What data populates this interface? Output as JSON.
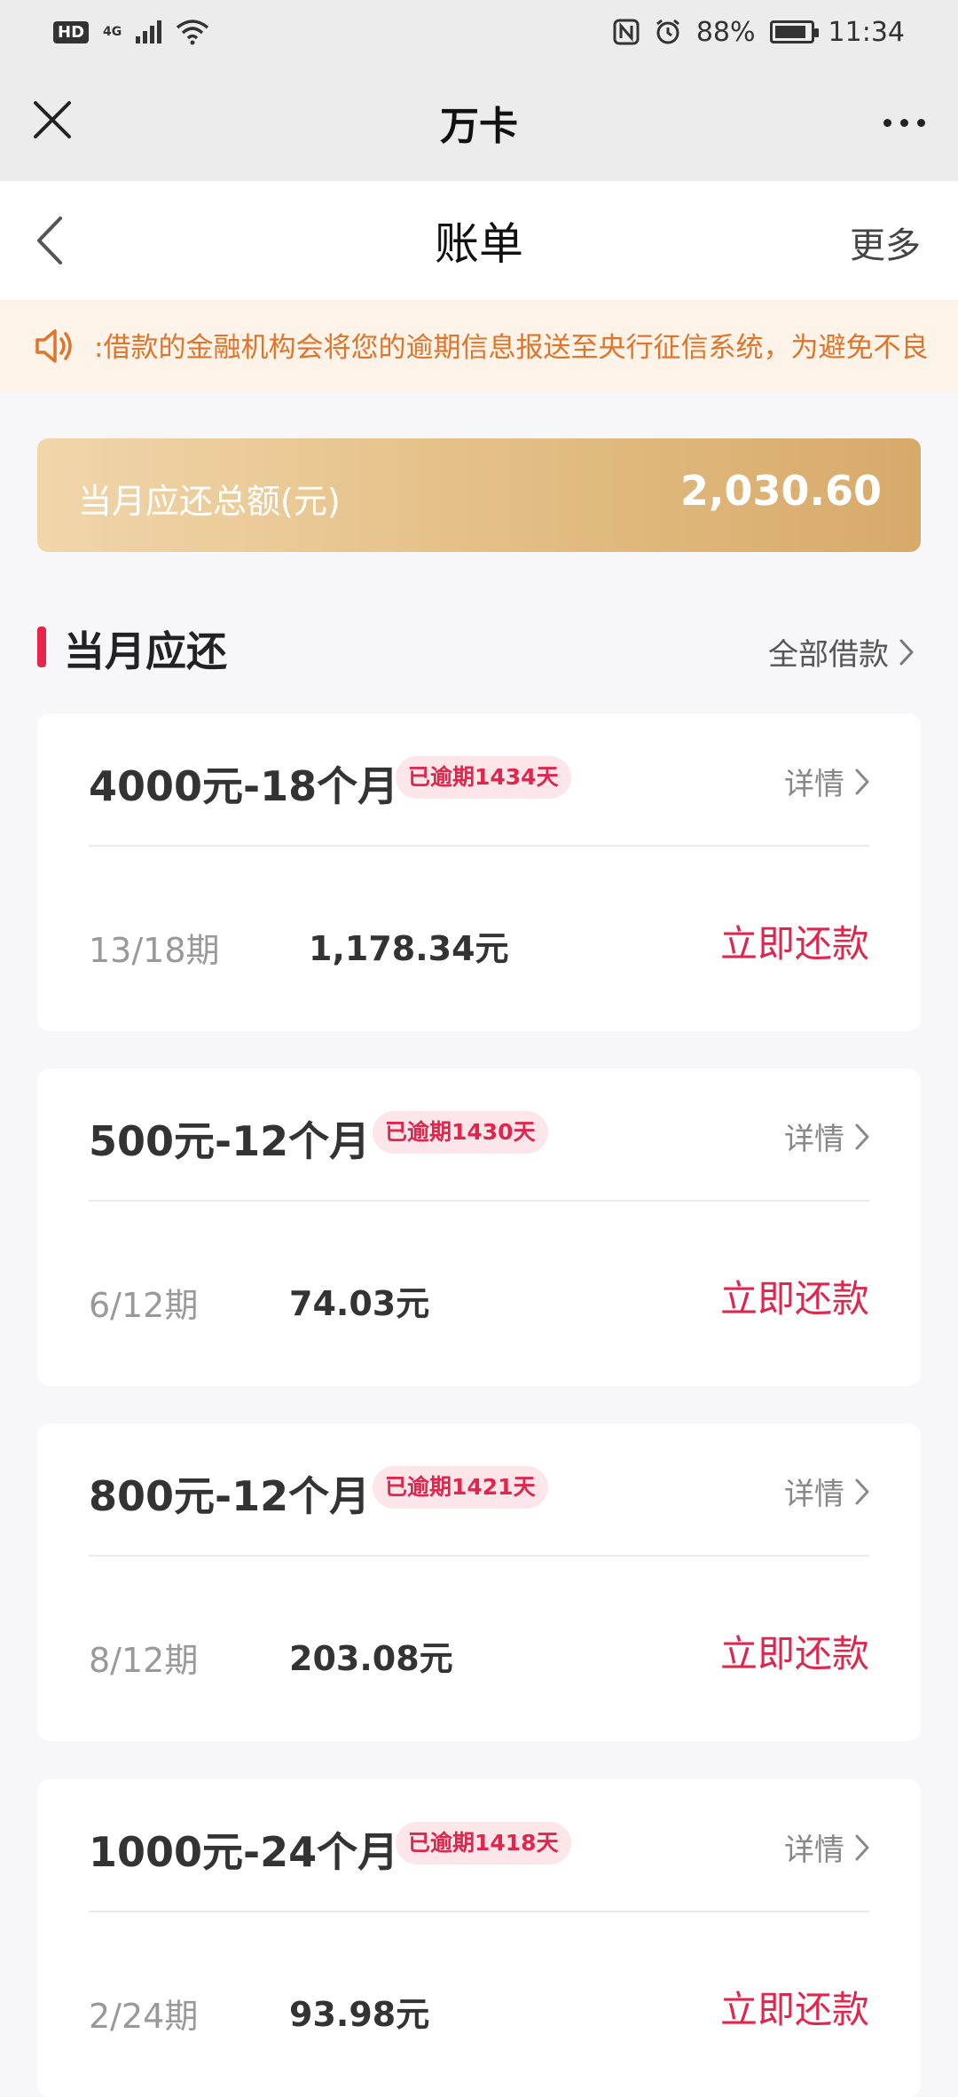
{
  "status_bar": {
    "hd": "HD",
    "net": "4G",
    "battery": "88%",
    "time": "11:34"
  },
  "mini_program": {
    "title": "万卡"
  },
  "page": {
    "title": "账单",
    "more": "更多"
  },
  "notice": {
    "text": ":借款的金融机构会将您的逾期信息报送至央行征信系统，为避免不良"
  },
  "summary": {
    "label": "当月应还总额(元)",
    "amount": "2,030.60"
  },
  "section": {
    "title": "当月应还",
    "all_loans": "全部借款"
  },
  "loans": [
    {
      "title": "4000元-18个月",
      "overdue": "已逾期1434天",
      "detail": "详情",
      "period": "13/18期",
      "amount": "1,178.34元",
      "action": "立即还款"
    },
    {
      "title": "500元-12个月",
      "overdue": "已逾期1430天",
      "detail": "详情",
      "period": "6/12期",
      "amount": "74.03元",
      "action": "立即还款"
    },
    {
      "title": "800元-12个月",
      "overdue": "已逾期1421天",
      "detail": "详情",
      "period": "8/12期",
      "amount": "203.08元",
      "action": "立即还款"
    },
    {
      "title": "1000元-24个月",
      "overdue": "已逾期1418天",
      "detail": "详情",
      "period": "2/24期",
      "amount": "93.98元",
      "action": "立即还款"
    }
  ],
  "colors": {
    "accent": "#e0264d",
    "notice_text": "#e0742a",
    "gold": "#d7aa6a"
  }
}
